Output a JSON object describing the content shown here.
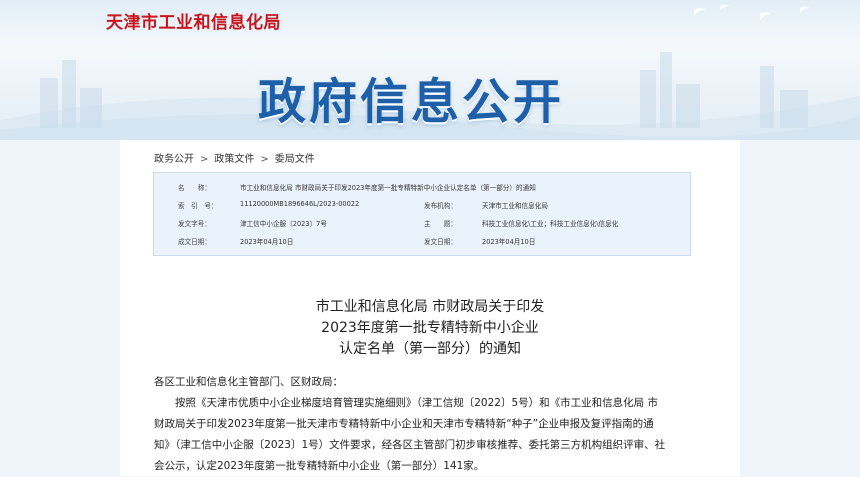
{
  "header": {
    "site_name": "天津市工业和信息化局",
    "banner_title": "政府信息公开"
  },
  "breadcrumb": {
    "items": [
      "政务公开",
      "政策文件",
      "委局文件"
    ],
    "separator": ">"
  },
  "meta": {
    "name_label": "名　　称：",
    "name_value": "市工业和信息化局 市财政局关于印发2023年度第一批专精特新中小企业认定名单（第一部分）的通知",
    "index_label": "索　引　号：",
    "index_value": "11120000MB1896646L/2023-00022",
    "issuer_label": "发布机构：",
    "issuer_value": "天津市工业和信息化局",
    "docno_label": "发文字号：",
    "docno_value": "津工信中小企服〔2023〕7号",
    "topic_label": "主　　题：",
    "topic_value": "科技工业信息化\\工业；科技工业信息化\\信息化",
    "created_label": "成文日期：",
    "created_value": "2023年04月10日",
    "published_label": "发文日期：",
    "published_value": "2023年04月10日"
  },
  "document": {
    "title_line1": "市工业和信息化局 市财政局关于印发",
    "title_line2": "2023年度第一批专精特新中小企业",
    "title_line3": "认定名单（第一部分）的通知",
    "salutation": "各区工业和信息化主管部门、区财政局：",
    "line1": "按照《天津市优质中小企业梯度培育管理实施细则》（津工信规〔2022〕5号）和《市工业和信息化局 市",
    "line2": "财政局关于印发2023年度第一批天津市专精特新中小企业和天津市专精特新“种子”企业申报及复评指南的通",
    "line3": "知》（津工信中小企服〔2023〕1号）文件要求，经各区主管部门初步审核推荐、委托第三方机构组织评审、社",
    "line4": "会公示，认定2023年度第一批专精特新中小企业（第一部分）141家。"
  },
  "colors": {
    "site_name": "#c8151d",
    "banner_title": "#1d5fa8",
    "meta_background": "#eaf3fb"
  }
}
